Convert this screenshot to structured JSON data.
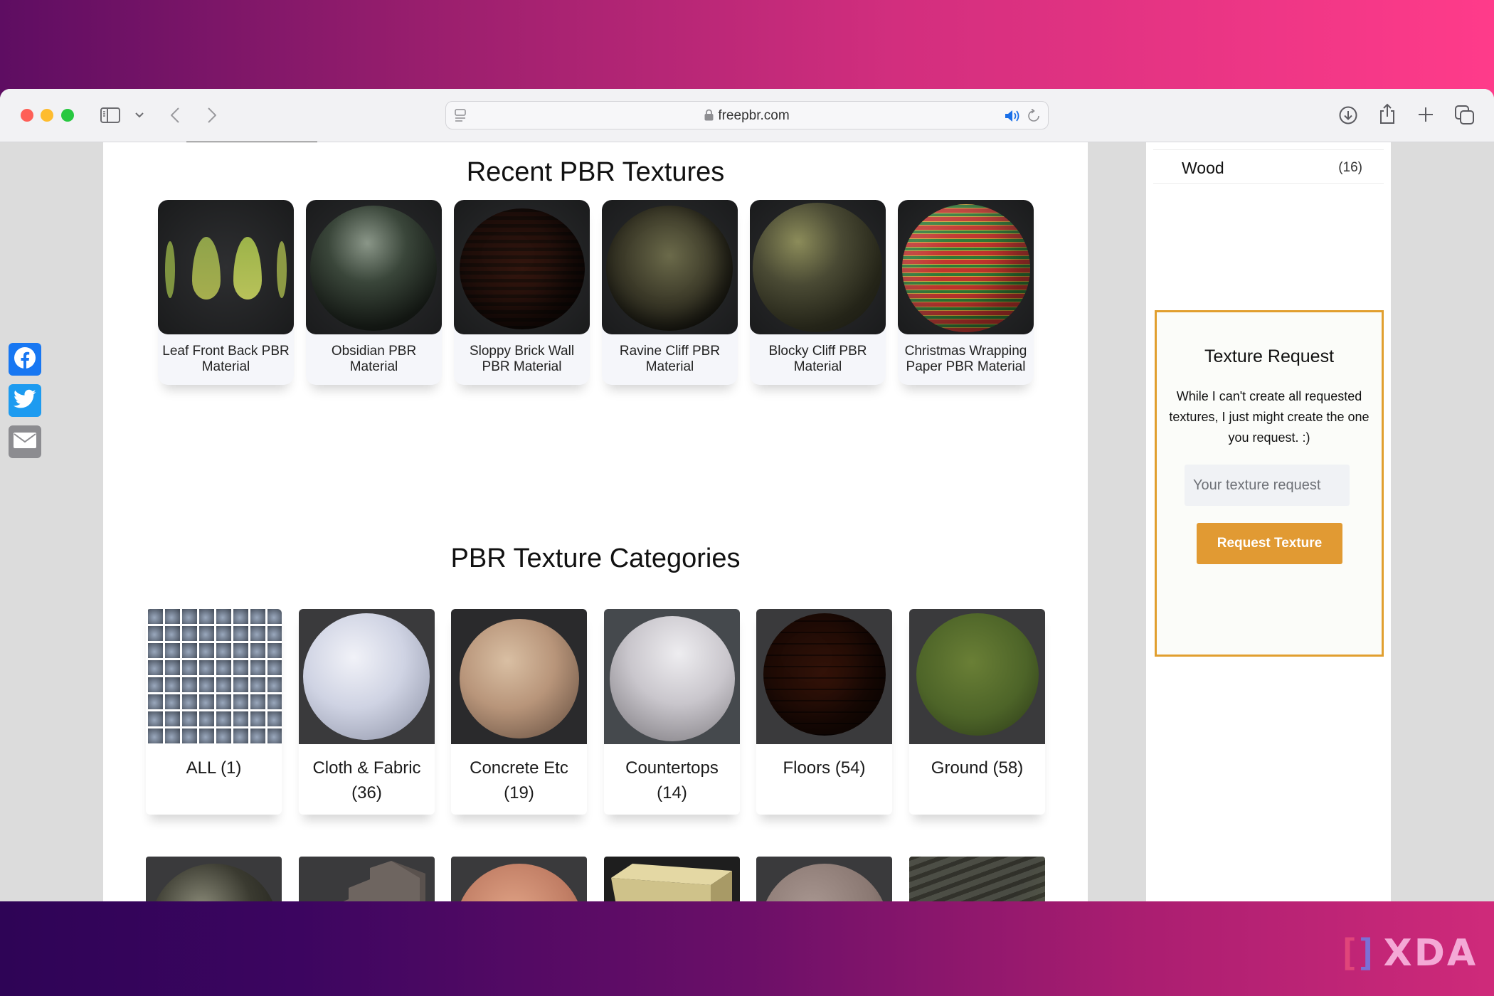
{
  "browser": {
    "url": "freepbr.com",
    "toolbar_icons": [
      "sidebar-toggle-icon",
      "chevron-down-icon",
      "back-icon",
      "forward-icon",
      "reader-icon",
      "lock-icon",
      "audio-playing-icon",
      "reload-icon",
      "download-icon",
      "share-icon",
      "new-tab-icon",
      "tab-overview-icon"
    ]
  },
  "share_buttons": [
    {
      "name": "facebook",
      "color": "#1877f2"
    },
    {
      "name": "twitter",
      "color": "#1da1f2"
    },
    {
      "name": "email",
      "color": "#8c8c90"
    }
  ],
  "recent": {
    "title": "Recent PBR Textures",
    "items": [
      {
        "label": "Leaf Front Back PBR Material"
      },
      {
        "label": "Obsidian PBR Material"
      },
      {
        "label": "Sloppy Brick Wall PBR Material"
      },
      {
        "label": "Ravine Cliff PBR Material"
      },
      {
        "label": "Blocky Cliff PBR Material"
      },
      {
        "label": "Christmas Wrapping Paper PBR Material"
      }
    ]
  },
  "categories": {
    "title": "PBR Texture Categories",
    "items": [
      {
        "name": "ALL",
        "count": "(1)"
      },
      {
        "name": "Cloth & Fabric",
        "count": "(36)"
      },
      {
        "name": "Concrete Etc",
        "count": "(19)"
      },
      {
        "name": "Countertops",
        "count": "(14)"
      },
      {
        "name": "Floors",
        "count": "(54)"
      },
      {
        "name": "Ground",
        "count": "(58)"
      }
    ]
  },
  "sidebar": {
    "category_row": {
      "name": "Wood",
      "count": "(16)"
    },
    "request": {
      "title": "Texture Request",
      "description": "While I can't create all requested textures, I just might create the one you request. :)",
      "input_placeholder": "Your texture request",
      "input_value": "",
      "button_label": "Request Texture",
      "accent_color": "#e19a33"
    }
  },
  "watermark": {
    "text": "XDA"
  }
}
